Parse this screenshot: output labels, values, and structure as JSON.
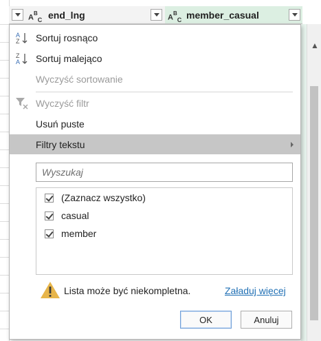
{
  "columns": [
    {
      "type_icon": "ABC",
      "name": "end_lng"
    },
    {
      "type_icon": "ABC",
      "name": "member_casual"
    }
  ],
  "menu": {
    "sort_asc": "Sortuj rosnąco",
    "sort_desc": "Sortuj malejąco",
    "clear_sort": "Wyczyść sortowanie",
    "clear_filter": "Wyczyść filtr",
    "remove_empty": "Usuń puste",
    "text_filters": "Filtry tekstu"
  },
  "search": {
    "placeholder": "Wyszukaj",
    "value": ""
  },
  "values": [
    {
      "label": "(Zaznacz wszystko)",
      "checked": true
    },
    {
      "label": "casual",
      "checked": true
    },
    {
      "label": "member",
      "checked": true
    }
  ],
  "warning": {
    "text": "Lista może być niekompletna.",
    "link": "Załaduj więcej"
  },
  "buttons": {
    "ok": "OK",
    "cancel": "Anuluj"
  },
  "icons": [
    "sort-ascending-icon",
    "sort-descending-icon",
    "clear-filter-icon",
    "warning-icon",
    "submenu-arrow-icon",
    "dropdown-arrow-icon",
    "text-type-icon",
    "checkbox-checked-icon"
  ],
  "colors": {
    "highlight": "#c6c6c6",
    "link": "#1f6fb4",
    "selected_column": "#dcefe2",
    "warning": "#e7b54a"
  }
}
